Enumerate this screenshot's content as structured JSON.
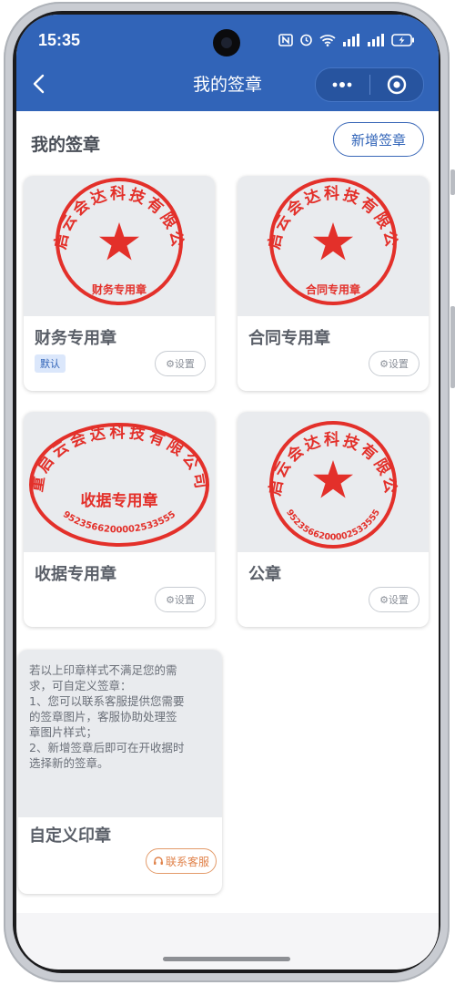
{
  "status_bar": {
    "time": "15:35"
  },
  "nav": {
    "title": "我的签章"
  },
  "section": {
    "title": "我的签章",
    "add_button": "新增签章"
  },
  "seals": [
    {
      "name": "财务专用章",
      "badge": "默认",
      "setting": "⚙设置",
      "shape": "round",
      "arc_text": "重启云会达科技有限公司",
      "center_text": "财务专用章",
      "number": ""
    },
    {
      "name": "合同专用章",
      "badge": "",
      "setting": "⚙设置",
      "shape": "round",
      "arc_text": "重启云会达科技有限公司",
      "center_text": "合同专用章",
      "number": ""
    },
    {
      "name": "收据专用章",
      "badge": "",
      "setting": "⚙设置",
      "shape": "oval",
      "arc_text": "重启云会达科技有限公司",
      "center_text": "收据专用章",
      "number": "9523566200002533555"
    },
    {
      "name": "公章",
      "badge": "",
      "setting": "⚙设置",
      "shape": "round",
      "arc_text": "重启云会达科技有限公司",
      "center_text": "",
      "number": "9523566200002533555"
    }
  ],
  "custom": {
    "description_lines": [
      "若以上印章样式不满足您的需",
      "求，可自定义签章：",
      "1、您可以联系客服提供您需要",
      "的签章图片，客服协助处理签",
      "章图片样式；",
      "2、新增签章后即可在开收据时",
      "选择新的签章。"
    ],
    "title": "自定义印章",
    "contact_button": "联系客服"
  },
  "colors": {
    "header": "#3164b8",
    "seal_red": "#e3302a",
    "accent_orange": "#e0824a"
  }
}
